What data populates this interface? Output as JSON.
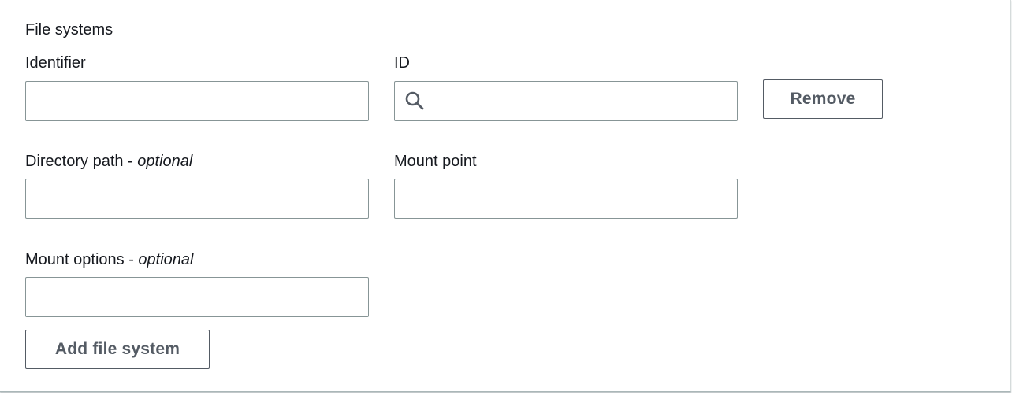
{
  "section": {
    "title": "File systems"
  },
  "fields": {
    "identifier": {
      "label": "Identifier",
      "value": "",
      "placeholder": ""
    },
    "id": {
      "label": "ID",
      "value": "",
      "placeholder": ""
    },
    "directory_path": {
      "label": "Directory path - ",
      "optional": "optional",
      "value": "",
      "placeholder": ""
    },
    "mount_point": {
      "label": "Mount point",
      "value": "",
      "placeholder": ""
    },
    "mount_options": {
      "label": "Mount options - ",
      "optional": "optional",
      "value": "",
      "placeholder": ""
    }
  },
  "buttons": {
    "remove": "Remove",
    "add_file_system": "Add file system"
  },
  "icons": {
    "search": "search-icon"
  },
  "colors": {
    "text": "#16191f",
    "border": "#879596",
    "button_text": "#545b64",
    "background": "#ffffff"
  }
}
